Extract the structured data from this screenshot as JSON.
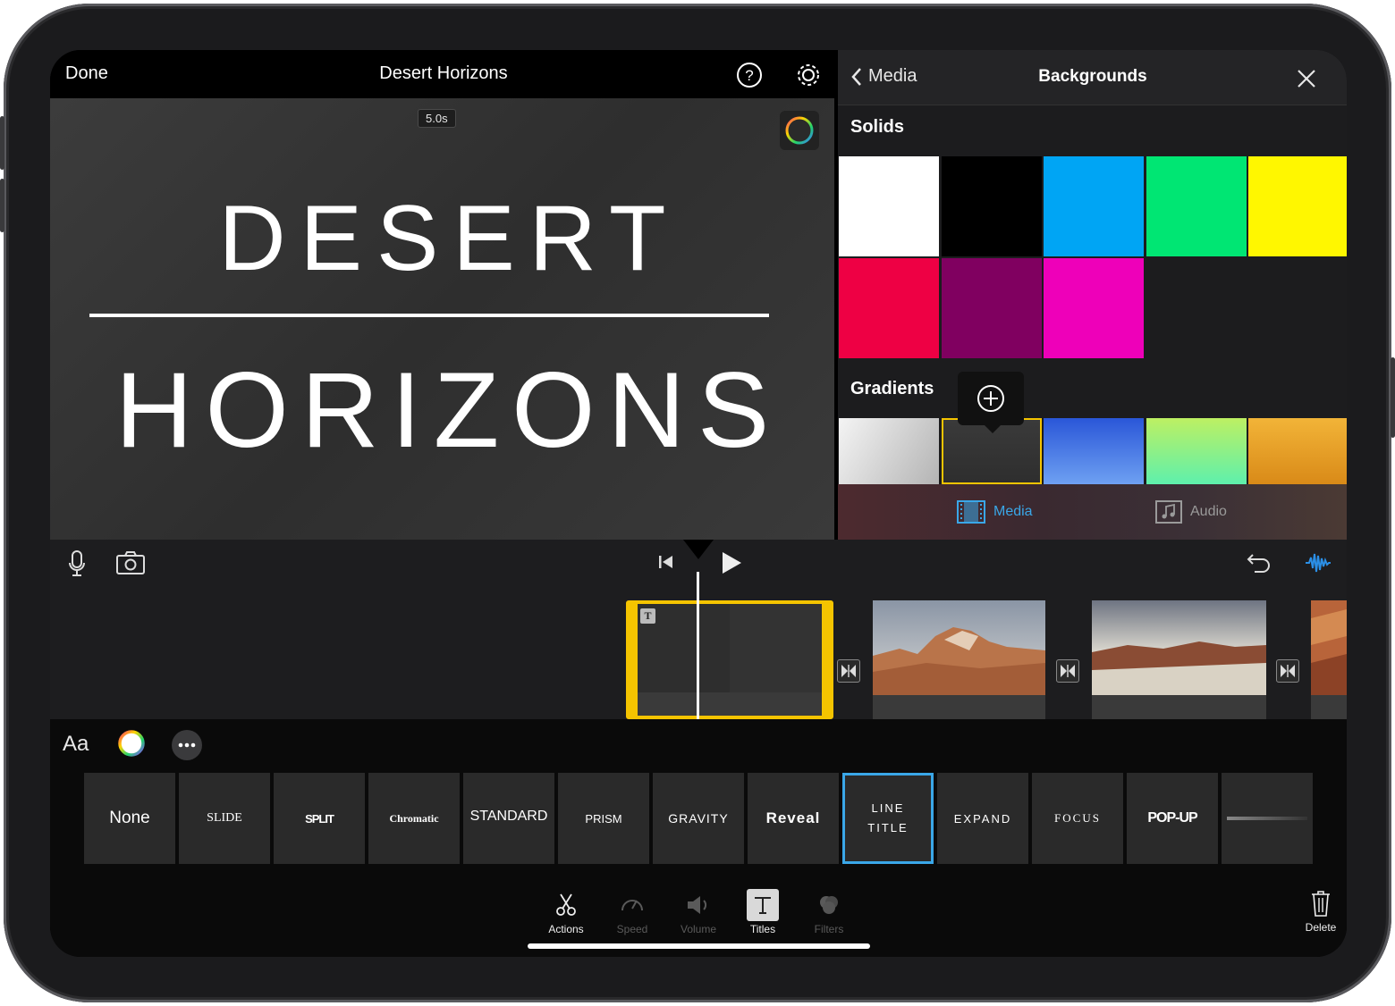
{
  "top_bar": {
    "done_label": "Done",
    "project_title": "Desert Horizons",
    "help_icon": "question-circle-icon",
    "settings_icon": "gear-icon"
  },
  "viewer": {
    "duration": "5.0s",
    "title_line1": "DESERT",
    "title_line2": "HORIZONS",
    "color_button_icon": "color-wheel-icon"
  },
  "backgrounds_panel": {
    "back_label": "Media",
    "title": "Backgrounds",
    "close_icon": "close-icon",
    "solids_heading": "Solids",
    "solids": [
      "#ffffff",
      "#000000",
      "#00a5f4",
      "#00e673",
      "#fff700",
      "#ee0044",
      "#800060",
      "#ee00b9"
    ],
    "gradients_heading": "Gradients",
    "gradients": [
      [
        "#f4f4f4",
        "#b4b4b4"
      ],
      [
        "#3a3a3a",
        "#2e2e2e"
      ],
      [
        "#2a56d8",
        "#6ea0f2"
      ],
      [
        "#bdf062",
        "#5ef0ac"
      ],
      [
        "#f2b438",
        "#d98a18"
      ]
    ],
    "selected_gradient_index": 1,
    "add_icon": "plus-circle-icon",
    "tabs": [
      {
        "label": "Media",
        "icon": "film-icon",
        "active": true
      },
      {
        "label": "Audio",
        "icon": "music-note-icon",
        "active": false
      }
    ]
  },
  "timeline_bar": {
    "mic_icon": "microphone-icon",
    "camera_icon": "camera-icon",
    "skip_back_icon": "skip-to-start-icon",
    "play_icon": "play-icon",
    "undo_icon": "undo-icon",
    "waveform_icon": "audio-waveform-icon"
  },
  "title_styles_toolbar": {
    "font_label": "Aa",
    "color_icon": "color-ring-icon",
    "more_icon": "ellipsis-icon",
    "styles": [
      "None",
      "SLIDE",
      "SPLIT",
      "Chromatic",
      "STANDARD",
      "PRISM",
      "GRAVITY",
      "Reveal",
      "LINE TITLE",
      "EXPAND",
      "FOCUS",
      "POP-UP",
      ""
    ],
    "selected_style": "LINE TITLE"
  },
  "inspector_tools": [
    {
      "label": "Actions",
      "icon": "scissors-icon",
      "enabled": true
    },
    {
      "label": "Speed",
      "icon": "speedometer-icon",
      "enabled": false
    },
    {
      "label": "Volume",
      "icon": "speaker-icon",
      "enabled": false
    },
    {
      "label": "Titles",
      "icon": "text-t-icon",
      "enabled": true,
      "active": true
    },
    {
      "label": "Filters",
      "icon": "filters-icon",
      "enabled": false
    }
  ],
  "delete_label": "Delete",
  "colors": {
    "accent_blue": "#3aa7e8",
    "selection_yellow": "#f5c400",
    "waveform_blue": "#2b8fe6"
  }
}
